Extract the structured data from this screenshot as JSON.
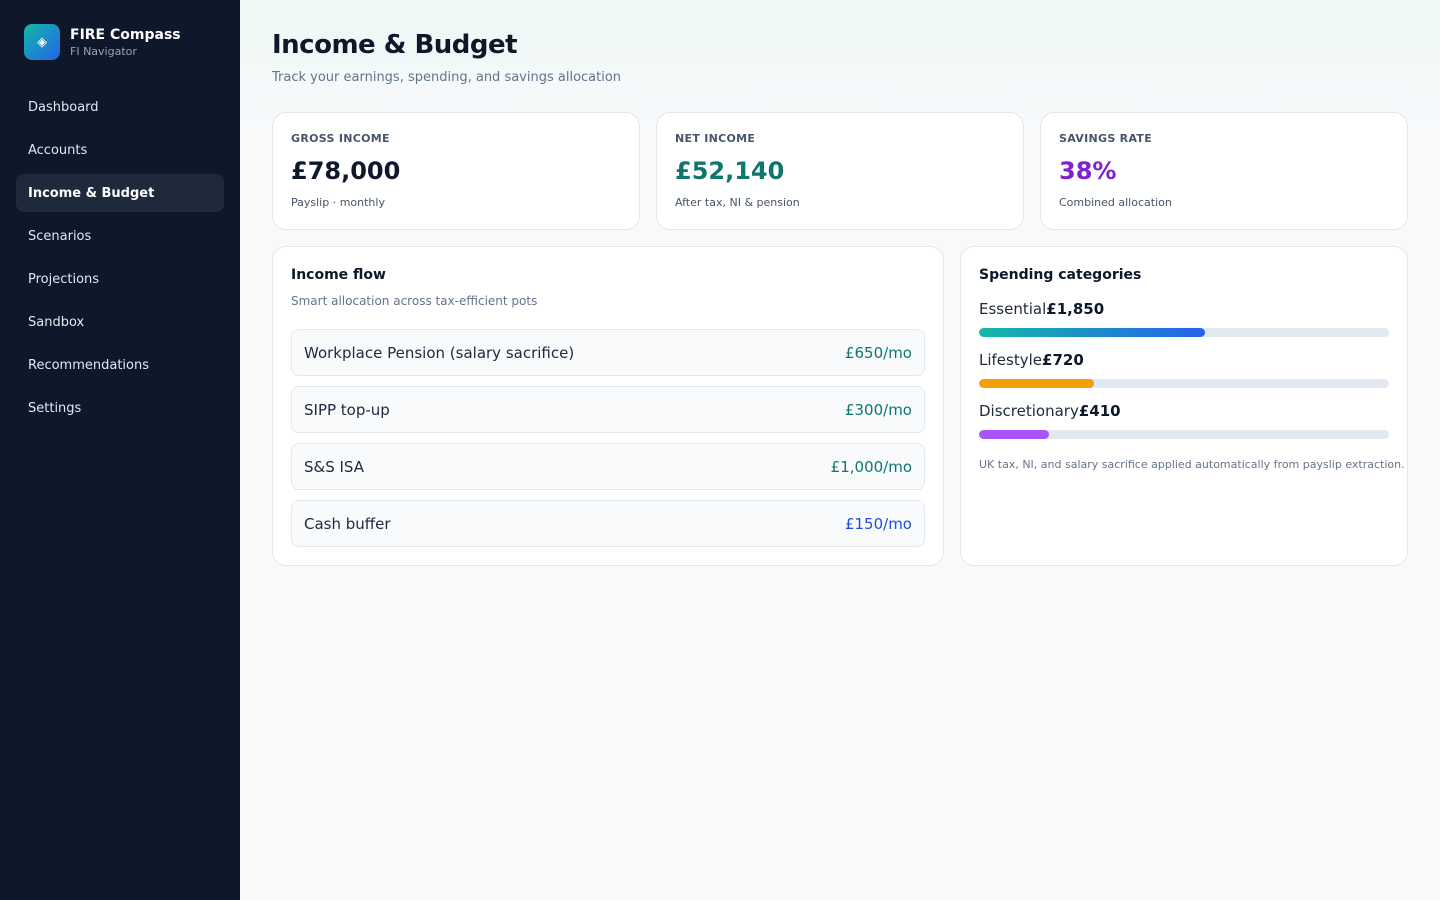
{
  "brand": {
    "name": "FIRE Compass",
    "tagline": "FI Navigator",
    "logo_icon": "diamond-icon"
  },
  "nav": {
    "items": [
      {
        "label": "Dashboard",
        "active": false
      },
      {
        "label": "Accounts",
        "active": false
      },
      {
        "label": "Income & Budget",
        "active": true
      },
      {
        "label": "Scenarios",
        "active": false
      },
      {
        "label": "Projections",
        "active": false
      },
      {
        "label": "Sandbox",
        "active": false
      },
      {
        "label": "Recommendations",
        "active": false
      },
      {
        "label": "Settings",
        "active": false
      }
    ]
  },
  "page": {
    "title": "Income & Budget",
    "subtitle": "Track your earnings, spending, and savings allocation"
  },
  "stats": [
    {
      "label": "GROSS INCOME",
      "value": "£78,000",
      "note": "Payslip · monthly",
      "color": "#0f172a"
    },
    {
      "label": "NET INCOME",
      "value": "£52,140",
      "note": "After tax, NI & pension",
      "color": "#0f766e"
    },
    {
      "label": "SAVINGS RATE",
      "value": "38%",
      "note": "Combined allocation",
      "color": "#7e22ce"
    }
  ],
  "income_flow": {
    "title": "Income flow",
    "subtitle": "Smart allocation across tax-efficient pots",
    "rows": [
      {
        "name": "Workplace Pension (salary sacrifice)",
        "amount": "£650/mo",
        "color": "#0f766e"
      },
      {
        "name": "SIPP top-up",
        "amount": "£300/mo",
        "color": "#0f766e"
      },
      {
        "name": "S&S ISA",
        "amount": "£1,000/mo",
        "color": "#0f766e"
      },
      {
        "name": "Cash buffer",
        "amount": "£150/mo",
        "color": "#1d4ed8"
      }
    ]
  },
  "spending": {
    "title": "Spending categories",
    "categories": [
      {
        "name": "Essential",
        "value": "£1,850",
        "fill_fraction": 0.55,
        "color_start": "#14b8a6",
        "color_end": "#2563eb"
      },
      {
        "name": "Lifestyle",
        "value": "£720",
        "fill_fraction": 0.28,
        "color_start": "#f59e0b",
        "color_end": "#f59e0b"
      },
      {
        "name": "Discretionary",
        "value": "£410",
        "fill_fraction": 0.17,
        "color_start": "#a855f7",
        "color_end": "#a855f7"
      }
    ],
    "note": "UK tax, NI, and salary sacrifice applied automatically from payslip extraction."
  }
}
